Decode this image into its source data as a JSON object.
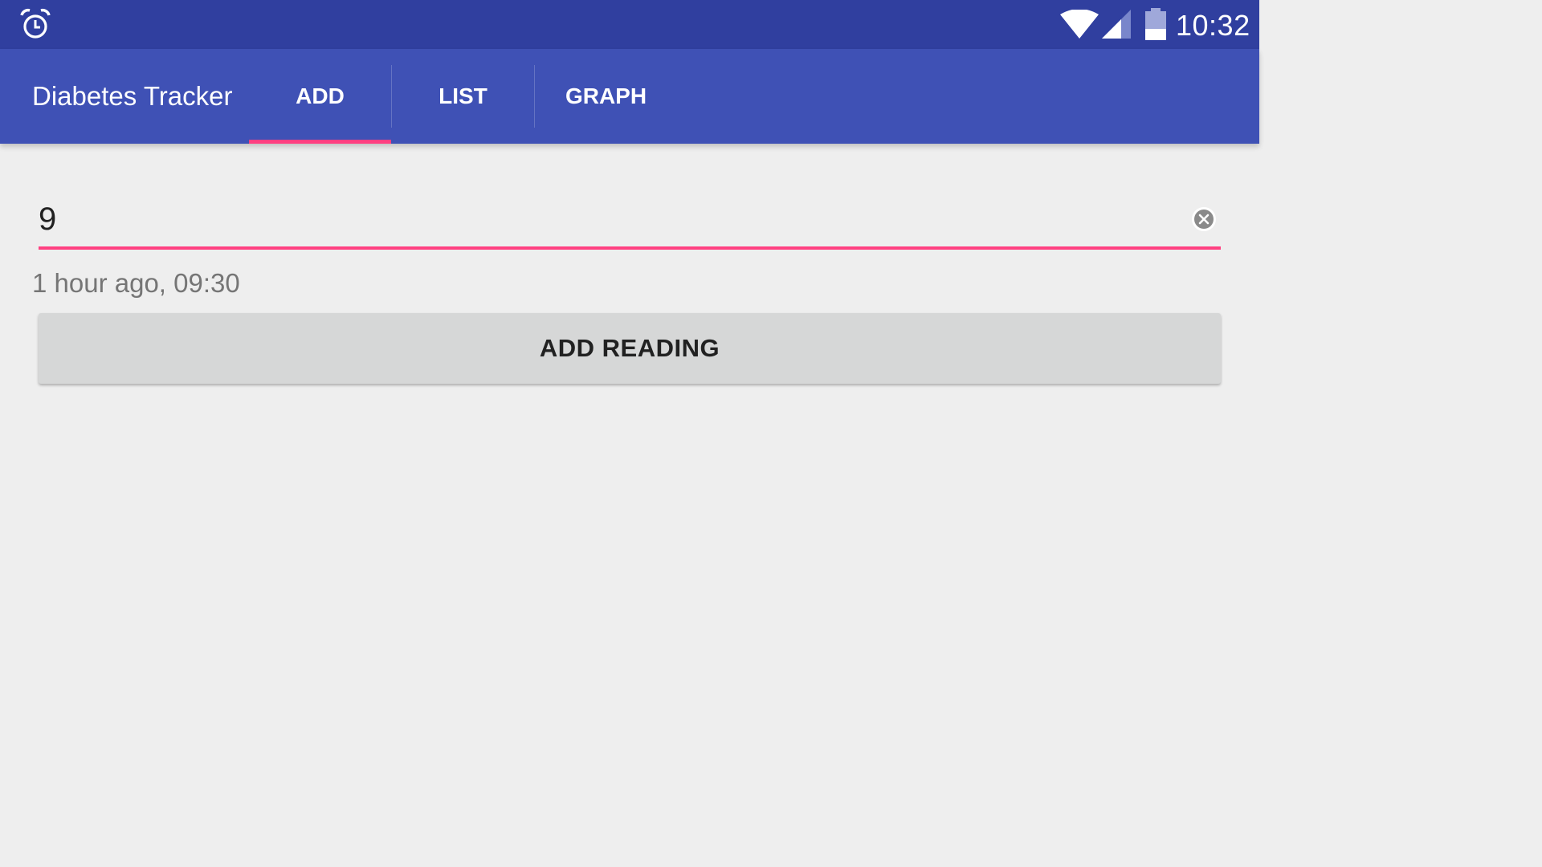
{
  "status_bar": {
    "time": "10:32",
    "icons": [
      "alarm-clock-icon",
      "wifi-icon",
      "cell-signal-icon",
      "battery-icon"
    ],
    "background_color": "#303f9f"
  },
  "app_bar": {
    "title": "Diabetes Tracker",
    "background_color": "#3f51b5",
    "tabs": [
      {
        "label": "ADD",
        "selected": true
      },
      {
        "label": "LIST",
        "selected": false
      },
      {
        "label": "GRAPH",
        "selected": false
      }
    ],
    "indicator_color": "#ff4081"
  },
  "form": {
    "reading_value": "9",
    "clear_icon": "clear-circle-icon",
    "timestamp": "1 hour ago, 09:30",
    "add_button_label": "ADD READING",
    "accent_color": "#ff4081"
  }
}
